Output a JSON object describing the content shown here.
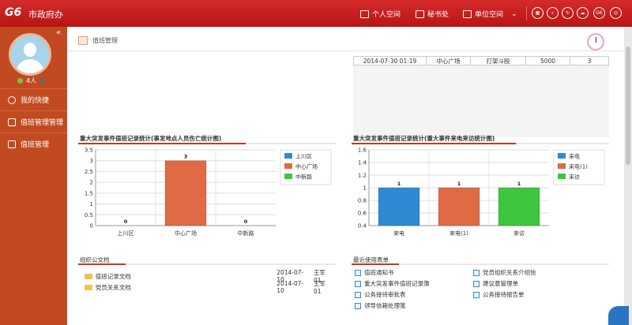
{
  "app": {
    "logo": "G6",
    "title": "市政府办"
  },
  "nav": {
    "personal": "个人空间",
    "secretariat": "秘书处",
    "unit": "单位空间",
    "g6": "G6"
  },
  "user": {
    "online": "4人"
  },
  "sidebar": {
    "items": [
      {
        "label": "我的快捷"
      },
      {
        "label": "值班管理管理"
      },
      {
        "label": "值班管理"
      }
    ]
  },
  "page": {
    "title": "值班管理"
  },
  "log_row": {
    "time": "2014-07-30 01:19",
    "place": "中心广场",
    "event": "打架斗殴",
    "a": "5000",
    "b": "3"
  },
  "chart1": {
    "title": "重大突发事件值班记录统计(事发地点人员伤亡统计图)",
    "colors": [
      "#2f8ad3",
      "#e06a44",
      "#3ec63e"
    ]
  },
  "chart2": {
    "title": "重大突发事件值班记录统计(重大事件来电来访统计图)",
    "colors": [
      "#2f8ad3",
      "#e06a44",
      "#3ec63e"
    ]
  },
  "chart_data": [
    {
      "type": "bar",
      "title": "重大突发事件值班记录统计(事发地点人员伤亡统计图)",
      "categories": [
        "上川区",
        "中心广场",
        "中新路"
      ],
      "values": [
        0,
        3,
        0
      ],
      "ylim": [
        0,
        3.5
      ],
      "yticks": [
        0,
        0.5,
        1,
        1.5,
        2,
        2.5,
        3,
        3.5
      ],
      "legend": [
        "上川区",
        "中心广场",
        "中新路"
      ],
      "legend_position": "top-right",
      "grid": true
    },
    {
      "type": "bar",
      "title": "重大突发事件值班记录统计(重大事件来电来访统计图)",
      "categories": [
        "来电",
        "来电(1)",
        "来访"
      ],
      "values": [
        1,
        1,
        1
      ],
      "ylim": [
        0.4,
        1.6
      ],
      "yticks": [
        0.4,
        0.6,
        0.8,
        1,
        1.2,
        1.4,
        1.6
      ],
      "legend": [
        "来电",
        "来电(1)",
        "来访"
      ],
      "legend_position": "top-right",
      "grid": true
    }
  ],
  "docs": {
    "title": "组织公文档",
    "rows": [
      {
        "name": "值班记录文档",
        "date": "2014-07-10",
        "user": "王军01"
      },
      {
        "name": "党员关系文档",
        "date": "2014-07-10",
        "user": "王军01"
      }
    ]
  },
  "forms": {
    "title": "最近使用表单",
    "left": [
      "值班通知书",
      "重大突发事件值班记录簿",
      "公务接待审批表",
      "领导信箱处理笺"
    ],
    "right": [
      "党员组织关系介绍信",
      "建议意管理单",
      "公务接待报告单"
    ]
  }
}
